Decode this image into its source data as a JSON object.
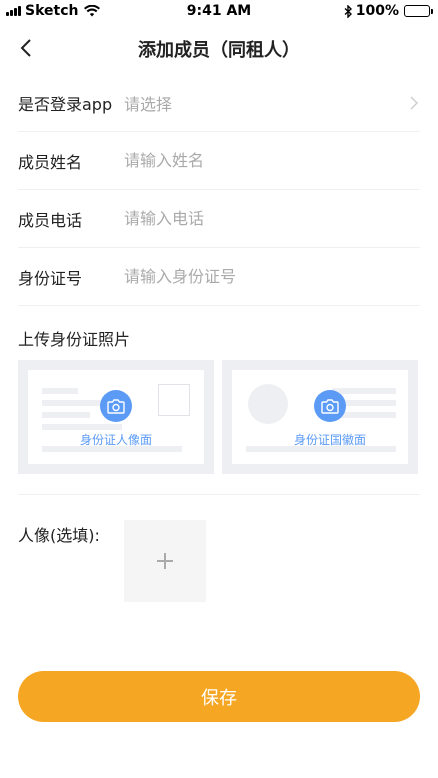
{
  "status_bar": {
    "carrier": "Sketch",
    "time": "9:41 AM",
    "battery_percent": "100%"
  },
  "nav": {
    "title": "添加成员（同租人）"
  },
  "form": {
    "login_app": {
      "label": "是否登录app",
      "placeholder": "请选择"
    },
    "name": {
      "label": "成员姓名",
      "placeholder": "请输入姓名"
    },
    "phone": {
      "label": "成员电话",
      "placeholder": "请输入电话"
    },
    "id_number": {
      "label": "身份证号",
      "placeholder": "请输入身份证号"
    }
  },
  "id_upload": {
    "title": "上传身份证照片",
    "front_caption": "身份证人像面",
    "back_caption": "身份证国徽面"
  },
  "portrait": {
    "label": "人像(选填):"
  },
  "save_button": {
    "label": "保存"
  },
  "colors": {
    "accent": "#f5a623",
    "camera_blue": "#5b9bf6",
    "placeholder_gray": "#aaaaaa"
  },
  "icons": [
    "signal-icon",
    "wifi-icon",
    "bluetooth-icon",
    "battery-icon",
    "back-chevron-icon",
    "chevron-right-icon",
    "camera-icon",
    "plus-icon"
  ]
}
